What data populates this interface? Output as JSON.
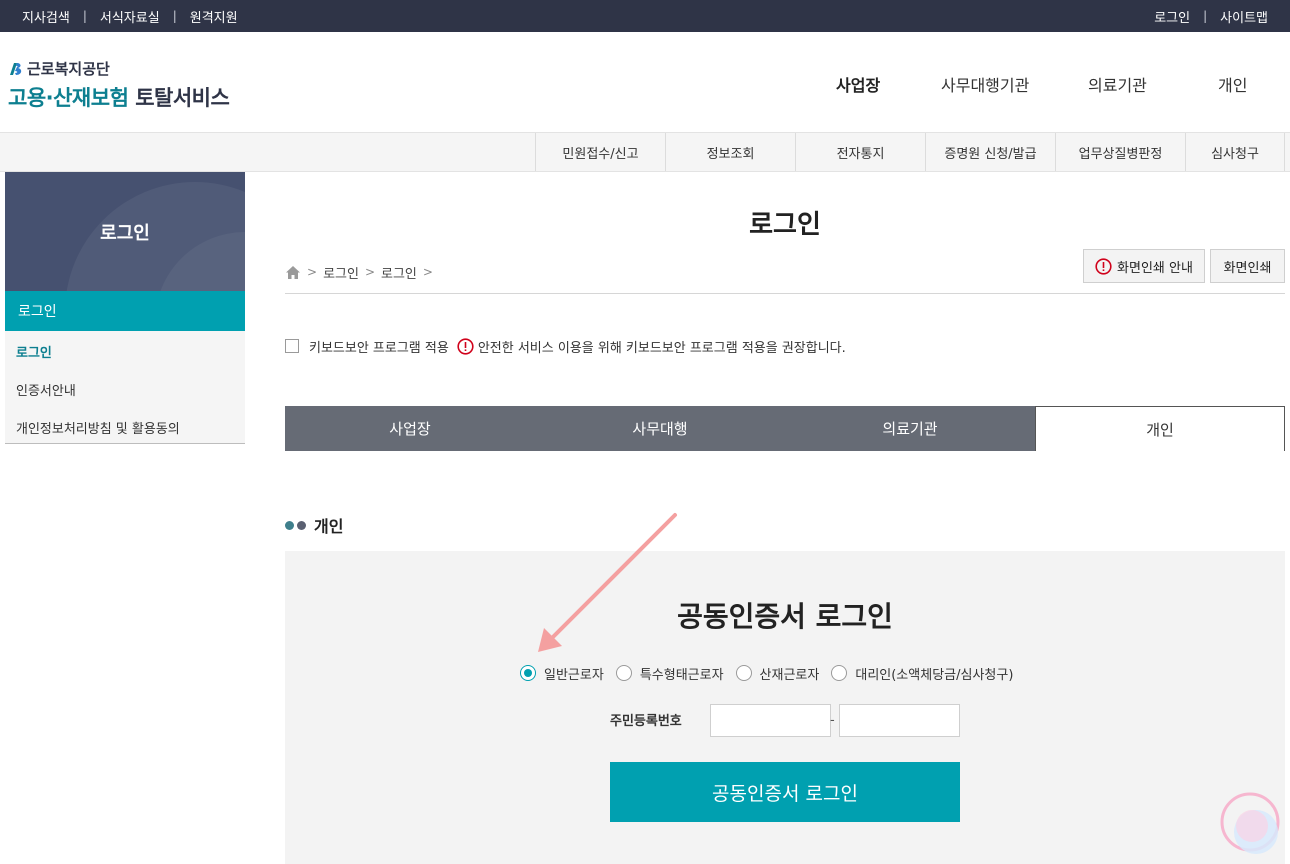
{
  "utilbar": {
    "left": [
      "지사검색",
      "서식자료실",
      "원격지원"
    ],
    "right": [
      "로그인",
      "사이트맵"
    ],
    "separator": "|"
  },
  "header": {
    "org_name": "근로복지공단",
    "service_part1": "고용·산재보험",
    "service_part2": "토탈서비스",
    "gnb": [
      "사업장",
      "사무대행기관",
      "의료기관",
      "개인"
    ]
  },
  "subnav": [
    "민원접수/신고",
    "정보조회",
    "전자통지",
    "증명원 신청/발급",
    "업무상질병판정",
    "심사청구"
  ],
  "sidebar": {
    "title": "로그인",
    "active": "로그인",
    "items": [
      "로그인",
      "인증서안내",
      "개인정보처리방침 및 활용동의"
    ]
  },
  "main": {
    "title": "로그인",
    "breadcrumb": [
      "로그인",
      "로그인"
    ],
    "print_guide": "화면인쇄 안내",
    "print": "화면인쇄",
    "keyboard_security_label": "키보드보안 프로그램 적용",
    "keyboard_security_notice": "안전한 서비스 이용을 위해 키보드보안 프로그램 적용을 권장합니다.",
    "tabs": [
      "사업장",
      "사무대행",
      "의료기관",
      "개인"
    ],
    "active_tab": "개인",
    "section_title": "개인",
    "login": {
      "title": "공동인증서 로그인",
      "radio_options": [
        "일반근로자",
        "특수형태근로자",
        "산재근로자",
        "대리인(소액체당금/심사청구)"
      ],
      "selected_option": "일반근로자",
      "rrn_label": "주민등록번호",
      "rrn_first": "",
      "rrn_second": "",
      "rrn_dash": "-",
      "button": "공동인증서 로그인"
    }
  },
  "colors": {
    "utilbar": "#2f3447",
    "accent": "#00a0b0",
    "sidebar_head": "#465170",
    "tab_inactive": "#666b75",
    "arrow": "#f4a0a0"
  }
}
